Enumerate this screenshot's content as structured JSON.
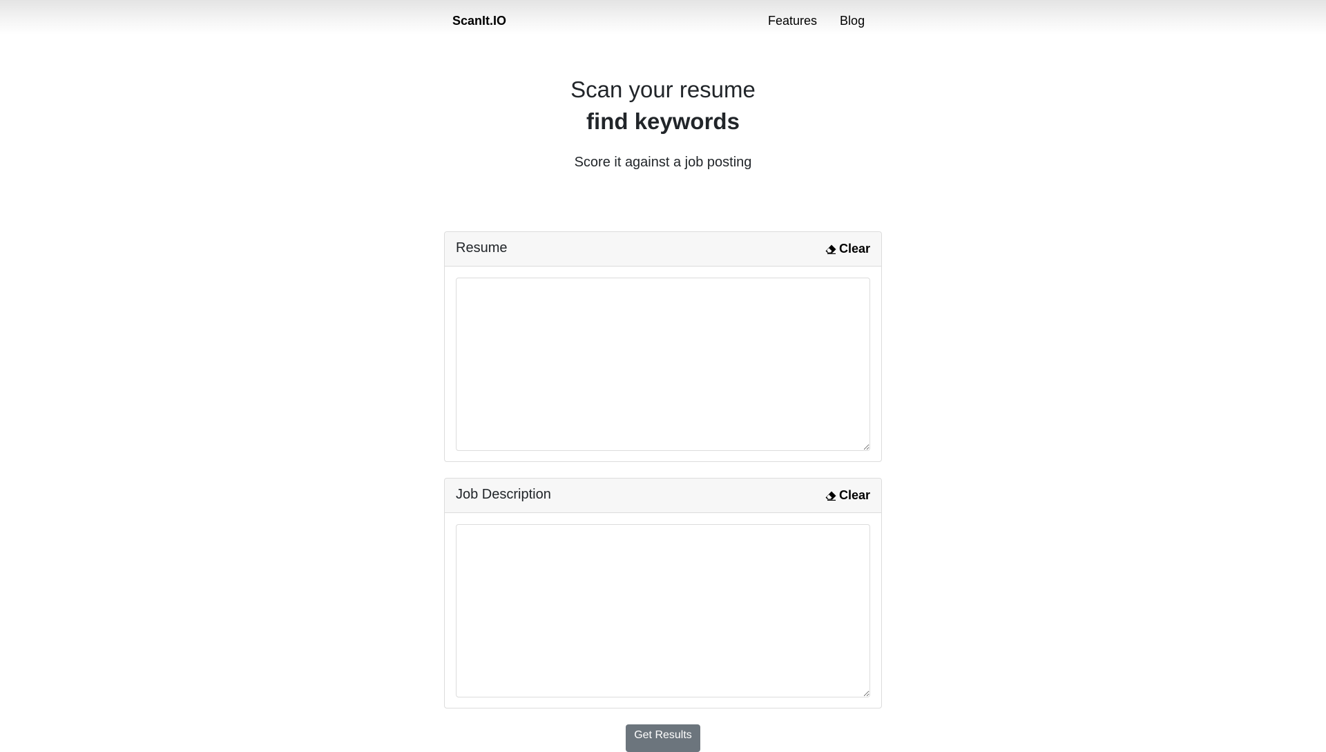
{
  "navbar": {
    "brand": "ScanIt.IO",
    "links": [
      "Features",
      "Blog"
    ]
  },
  "hero": {
    "line1": "Scan your resume",
    "line2": "find keywords",
    "subtitle": "Score it against a job posting"
  },
  "resume_card": {
    "title": "Resume",
    "clear_label": "Clear",
    "textarea_value": ""
  },
  "job_card": {
    "title": "Job Description",
    "clear_label": "Clear",
    "textarea_value": ""
  },
  "submit": {
    "label": "Get Results"
  },
  "icons": {
    "clear": "eraser-icon"
  },
  "colors": {
    "button_bg": "#6c757d",
    "card_border": "#dcdcdc",
    "card_header_bg": "#f7f7f7"
  }
}
